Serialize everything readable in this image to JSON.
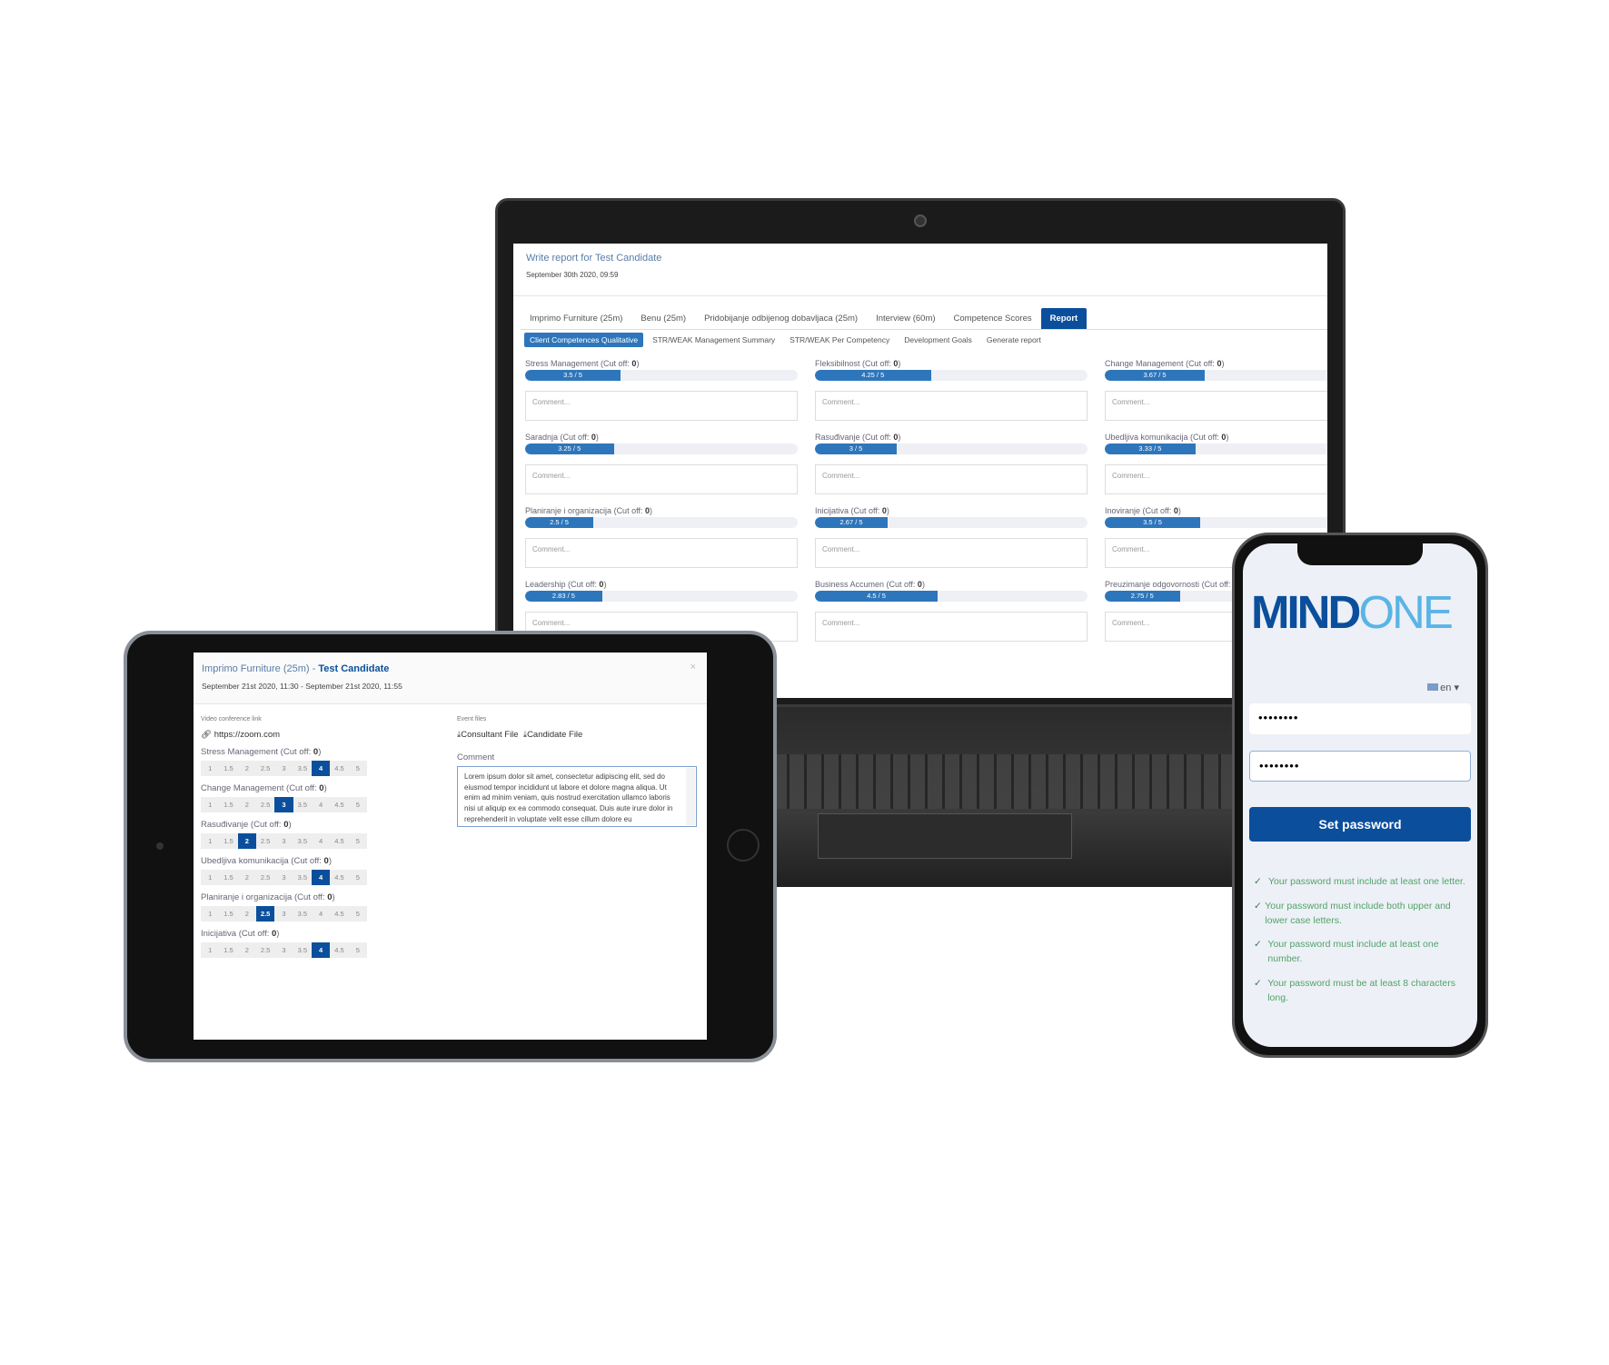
{
  "laptop": {
    "title": "Write report for Test Candidate",
    "date": "September 30th 2020, 09:59",
    "tabs": [
      {
        "label": "Imprimo Furniture (25m)",
        "active": false
      },
      {
        "label": "Benu (25m)",
        "active": false
      },
      {
        "label": "Pridobijanje odbijenog dobavljaca (25m)",
        "active": false
      },
      {
        "label": "Interview (60m)",
        "active": false
      },
      {
        "label": "Competence Scores",
        "active": false
      },
      {
        "label": "Report",
        "active": true
      }
    ],
    "subtabs": [
      {
        "label": "Client Competences Qualitative",
        "active": true
      },
      {
        "label": "STR/WEAK Management Summary",
        "active": false
      },
      {
        "label": "STR/WEAK Per Competency",
        "active": false
      },
      {
        "label": "Development Goals",
        "active": false
      },
      {
        "label": "Generate report",
        "active": false
      }
    ],
    "cutoff_label": "Cut off:",
    "comment_placeholder": "Comment...",
    "competences": [
      {
        "name": "Stress Management",
        "cutoff": "0",
        "score": 3.5,
        "score_label": "3.5 / 5"
      },
      {
        "name": "Fleksibilnost",
        "cutoff": "0",
        "score": 4.25,
        "score_label": "4.25 / 5"
      },
      {
        "name": "Change Management",
        "cutoff": "0",
        "score": 3.67,
        "score_label": "3.67 / 5"
      },
      {
        "name": "Saradnja",
        "cutoff": "0",
        "score": 3.25,
        "score_label": "3.25 / 5"
      },
      {
        "name": "Rasuđivanje",
        "cutoff": "0",
        "score": 3,
        "score_label": "3 / 5"
      },
      {
        "name": "Ubedljiva komunikacija",
        "cutoff": "0",
        "score": 3.33,
        "score_label": "3.33 / 5"
      },
      {
        "name": "Planiranje i organizacija",
        "cutoff": "0",
        "score": 2.5,
        "score_label": "2.5 / 5"
      },
      {
        "name": "Inicijativa",
        "cutoff": "0",
        "score": 2.67,
        "score_label": "2.67 / 5"
      },
      {
        "name": "Inoviranje",
        "cutoff": "0",
        "score": 3.5,
        "score_label": "3.5 / 5"
      },
      {
        "name": "Leadership",
        "cutoff": "0",
        "score": 2.83,
        "score_label": "2.83 / 5"
      },
      {
        "name": "Business Accumen",
        "cutoff": "0",
        "score": 4.5,
        "score_label": "4.5 / 5"
      },
      {
        "name": "Preuzimanje odgovornosti",
        "cutoff": "0",
        "score": 2.75,
        "score_label": "2.75 / 5"
      }
    ],
    "max_score": 5
  },
  "tablet": {
    "title_event": "Imprimo Furniture (25m) - ",
    "title_candidate": "Test Candidate",
    "date": "September 21st 2020, 11:30 - September 21st 2020, 11:55",
    "close": "×",
    "video_label": "Video conference link",
    "video_link": "https://zoom.com",
    "files_label": "Event files",
    "files": [
      "Consultant File",
      "Candidate File"
    ],
    "comment_label": "Comment",
    "comment_text": "Lorem ipsum dolor sit amet, consectetur adipiscing elit, sed do eiusmod tempor incididunt ut labore et dolore magna aliqua. Ut enim ad minim veniam, quis nostrud exercitation ullamco laboris nisi ut aliquip ex ea commodo consequat. Duis aute irure dolor in reprehenderit in voluptate velit esse cillum dolore eu",
    "cutoff_label": "Cut off:",
    "scale": [
      "1",
      "1.5",
      "2",
      "2.5",
      "3",
      "3.5",
      "4",
      "4.5",
      "5"
    ],
    "competences": [
      {
        "name": "Stress Management",
        "cutoff": "0",
        "selected": "4"
      },
      {
        "name": "Change Management",
        "cutoff": "0",
        "selected": "3"
      },
      {
        "name": "Rasuđivanje",
        "cutoff": "0",
        "selected": "2"
      },
      {
        "name": "Ubedljiva komunikacija",
        "cutoff": "0",
        "selected": "4"
      },
      {
        "name": "Planiranje i organizacija",
        "cutoff": "0",
        "selected": "2.5"
      },
      {
        "name": "Inicijativa",
        "cutoff": "0",
        "selected": "4"
      }
    ]
  },
  "phone": {
    "logo_dark": "MIND",
    "logo_light": "ONE",
    "language": "en",
    "password": "••••••••",
    "password_confirm": "••••••••",
    "submit": "Set password",
    "requirements": [
      "Your password must include at least one letter.",
      "Your password must include both upper and lower case letters.",
      "Your password must include at least one number.",
      "Your password must be at least 8 characters long."
    ],
    "colors": {
      "brand_dark": "#0b4f9c",
      "brand_light": "#5ab4e6",
      "success": "#52a36a"
    }
  }
}
